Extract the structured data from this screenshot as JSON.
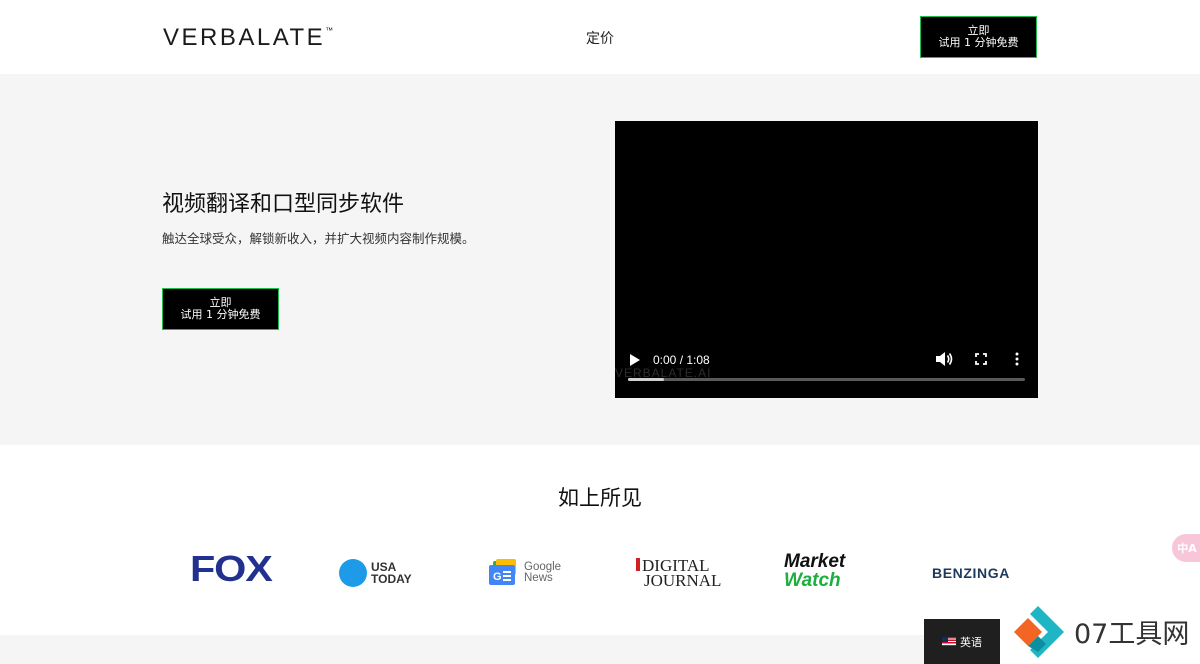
{
  "header": {
    "logo": "VERBALATE",
    "logo_tm": "™",
    "nav_pricing": "定价",
    "cta_line1": "立即",
    "cta_line2": "试用 1 分钟免费"
  },
  "hero": {
    "title": "视频翻译和口型同步软件",
    "subtitle": "触达全球受众，解锁新收入，并扩大视频内容制作规模。",
    "cta_line1": "立即",
    "cta_line2": "试用 1 分钟免费",
    "video": {
      "watermark": "VERBALATE.AI",
      "time": "0:00 / 1:08",
      "progress": 0.09
    }
  },
  "seen": {
    "title": "如上所见",
    "logos": {
      "fox": "FOX",
      "usa_line1": "USA",
      "usa_line2": "TODAY",
      "gnews_line1": "Google",
      "gnews_line2": "News",
      "dj_line1": "DIGITAL",
      "dj_line2": "JOURNAL",
      "mw_line1": "Market",
      "mw_line2": "Watch",
      "benzinga": "BENZINGA"
    }
  },
  "language": {
    "label": "英语"
  },
  "site_badge": {
    "name": "07工具网"
  },
  "translate_pill": {
    "label": "中A"
  },
  "colors": {
    "accent_border": "#1fbf4f",
    "hero_bg": "#f5f5f5",
    "fox_blue": "#22318f",
    "usa_blue": "#1e9be8",
    "marketwatch_green": "#1cae3f"
  }
}
